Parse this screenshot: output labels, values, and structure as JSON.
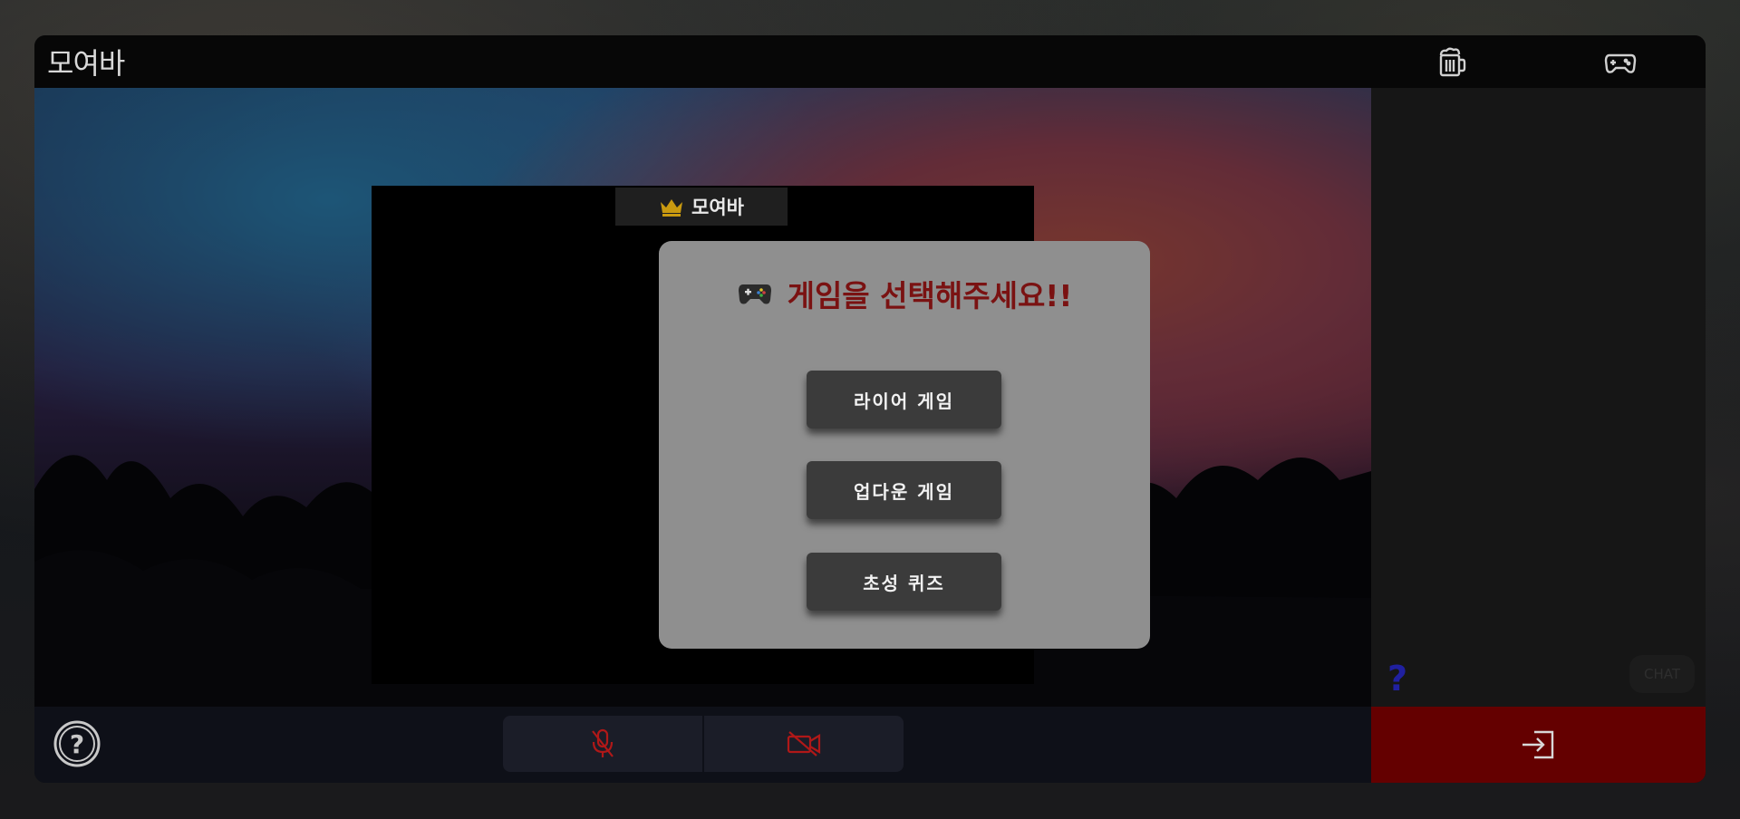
{
  "app": {
    "title": "모여바"
  },
  "header": {
    "icons": [
      "beer-mug-icon",
      "gamepad-icon"
    ]
  },
  "stage": {
    "host_label": "모여바",
    "host_icon": "crown-icon"
  },
  "modal": {
    "title": "게임을 선택해주세요!!",
    "title_icon": "gamepad-icon",
    "options": [
      "라이어 게임",
      "업다운 게임",
      "초성 퀴즈"
    ]
  },
  "side_panel": {
    "help_mark": "?",
    "chat_label": "CHAT"
  },
  "bottom_bar": {
    "help_icon": "question-circle-icon",
    "mic_icon": "mic-off-icon",
    "camera_icon": "camera-off-icon",
    "exit_icon": "exit-icon"
  },
  "colors": {
    "modal_bg": "#8f8f8f",
    "title_red": "#7a1212",
    "exit_red": "#640000",
    "button_bg": "#3b3b3b",
    "muted_red": "#b01818"
  }
}
